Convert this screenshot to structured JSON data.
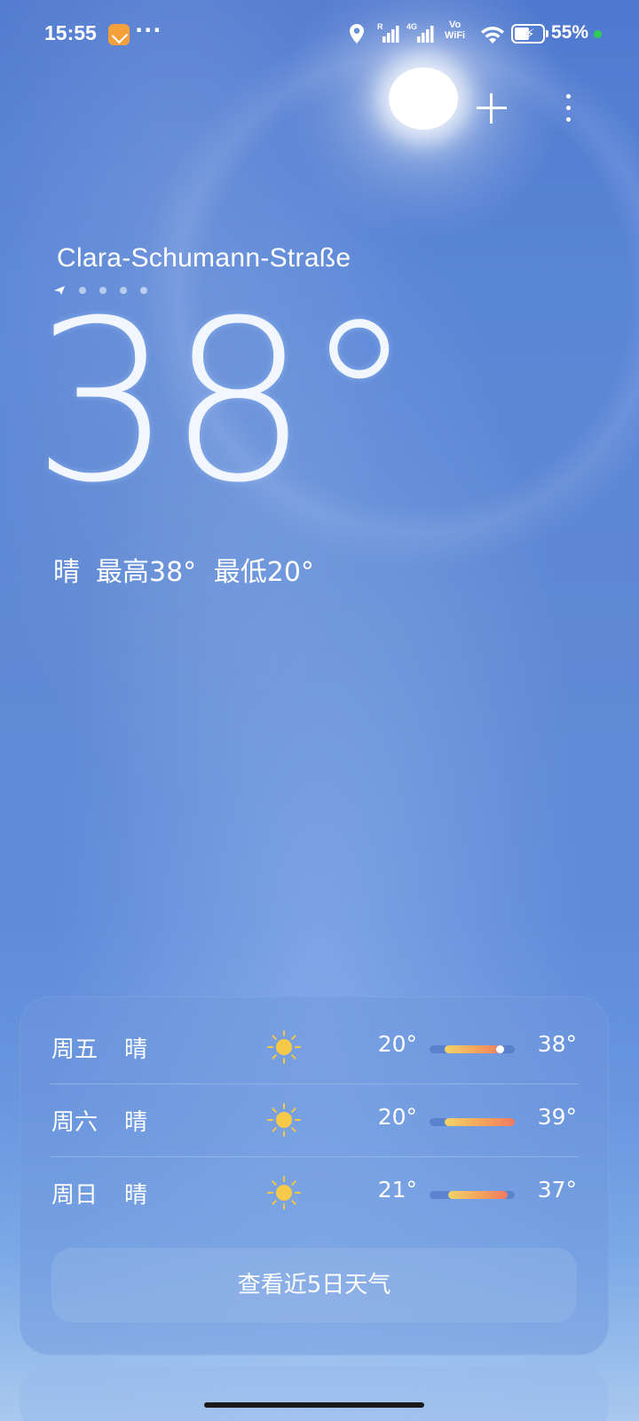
{
  "status_bar": {
    "time": "15:55",
    "notification_icon": "app-notification-icon",
    "more_indicator": "···",
    "icons": [
      "location-icon",
      "signal-r-icon",
      "signal-4g-icon",
      "vowifi-icon",
      "wifi-icon",
      "battery-charging-icon"
    ],
    "signal_r_label": "R",
    "signal_4g_label": "4G",
    "vowifi_line1": "Vo",
    "vowifi_line2": "WiFi",
    "battery_percent": "55%",
    "battery_level": 0.55,
    "charging_dot_color": "#2ecc55"
  },
  "header": {
    "add_icon": "plus-icon",
    "menu_icon": "more-vertical-icon"
  },
  "location": {
    "city": "Clara-Schumann-Straße",
    "page_count": 5,
    "current_page_icon": "navigation-arrow-icon"
  },
  "current": {
    "temperature": "38°",
    "condition": "晴",
    "high": "最高38°",
    "low": "最低20°"
  },
  "forecast": {
    "days": [
      {
        "day": "周五",
        "condition": "晴",
        "icon": "sun-icon",
        "low": "20°",
        "high": "38°",
        "range_start": 0.18,
        "range_end": 0.87,
        "current_marker": 0.87
      },
      {
        "day": "周六",
        "condition": "晴",
        "icon": "sun-icon",
        "low": "20°",
        "high": "39°",
        "range_start": 0.18,
        "range_end": 1.0
      },
      {
        "day": "周日",
        "condition": "晴",
        "icon": "sun-icon",
        "low": "21°",
        "high": "37°",
        "range_start": 0.22,
        "range_end": 0.92
      }
    ],
    "more_button_label": "查看近5日天气"
  },
  "colors": {
    "sky_top": "#4f79cf",
    "sky_bottom": "#a9c9ee",
    "temp_bar_start": "#f3d36a",
    "temp_bar_end": "#f07a62"
  }
}
